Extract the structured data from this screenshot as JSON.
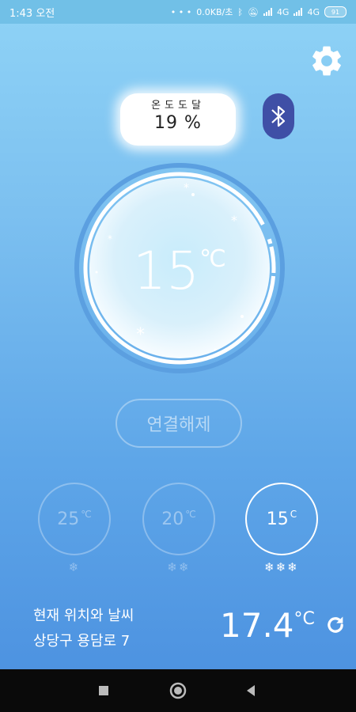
{
  "status_bar": {
    "time": "1:43 오전",
    "network_speed": "0.0KB/초",
    "network1": "4G",
    "network2": "4G",
    "battery": "91"
  },
  "arrival": {
    "label": "온도도달",
    "value": "19 %"
  },
  "dial": {
    "temperature": "15",
    "unit": "℃"
  },
  "disconnect_button": "연결해제",
  "presets": [
    {
      "temp": "25",
      "unit": "℃",
      "snowflakes": "❄",
      "active": false
    },
    {
      "temp": "20",
      "unit": "℃",
      "snowflakes": "❄❄",
      "active": false
    },
    {
      "temp": "15",
      "unit": "C",
      "snowflakes": "❄❄❄",
      "active": true
    }
  ],
  "weather": {
    "label": "현재 위치와 날씨",
    "address": "상당구 용담로 7",
    "temperature": "17.4",
    "unit": "°C"
  },
  "icons": {
    "settings": "gear-icon",
    "bluetooth": "bluetooth-icon",
    "refresh": "refresh-icon"
  },
  "colors": {
    "bluetooth_bg": "#3f4fa6",
    "background_top": "#8fd3f6",
    "background_bottom": "#4a8fdf"
  }
}
